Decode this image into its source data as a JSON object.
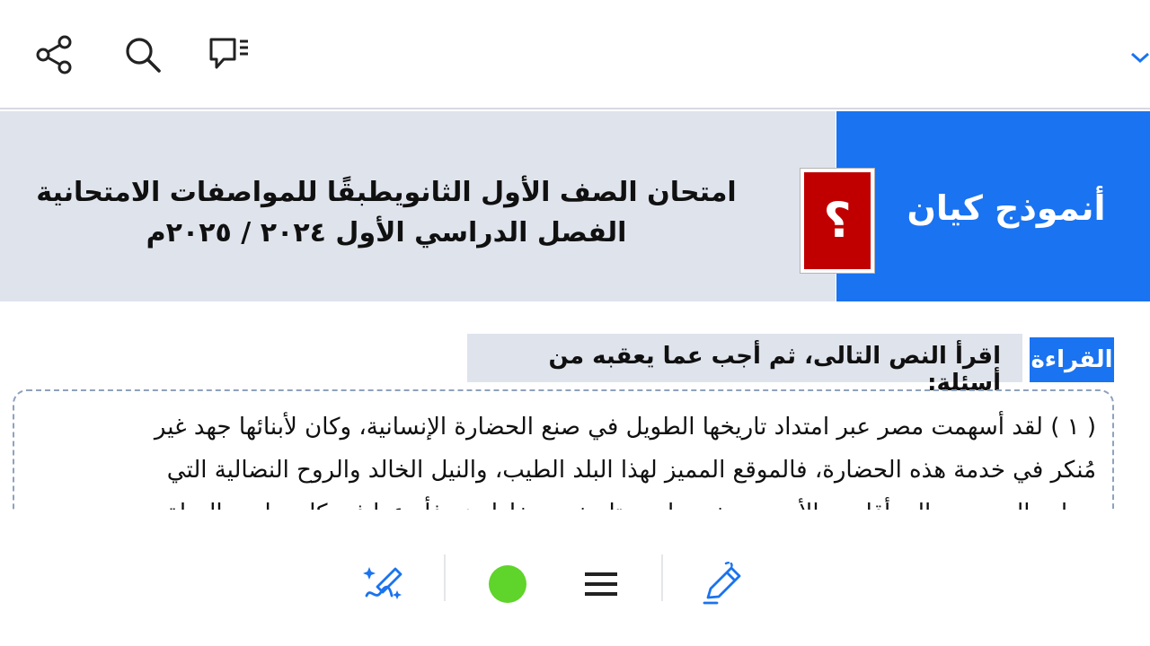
{
  "toolbar": {
    "icons": [
      "share-icon",
      "search-icon",
      "comments-icon",
      "chevron-down-icon"
    ],
    "accent": "#1a73f0"
  },
  "document": {
    "model_name": "أنموذج كيان",
    "badge_symbol": "؟",
    "title_line1": "امتحان الصف الأول الثانويطبقًا للمواصفات الامتحانية",
    "title_line2": "الفصل الدراسي الأول ٢٠٢٤ / ٢٠٢٥م",
    "reading_label": "القراءة",
    "instruction": "اقرأ النص التالى، ثم أجب عما يعقبه من أسئلة:",
    "passage_line1": "( ١ ) لقد أسهمت مصر عبر امتداد تاريخها الطويل في صنع الحضارة الإنسانية، وكان لأبنائها جهد غير",
    "passage_line2": "مُنكر في خدمة هذه الحضارة، فالموقع المميز لهذا البلد الطيب، والنيل الخالد والروح النضالية التي",
    "passage_line3": "حملت المصريين إلى أقاصي الأرض ومخرجوا من تاريخهم وخاطرهم فأبدعوا في كل ميادين الحياة",
    "colors": {
      "banner_grey": "#dfe3ec",
      "banner_blue": "#1a73f0",
      "badge_red": "#c00000"
    }
  },
  "bottombar": {
    "icons": [
      "magic-pen-icon",
      "color-swatch",
      "menu-icon",
      "pen-icon"
    ],
    "selected_color": "#5fd42a"
  }
}
